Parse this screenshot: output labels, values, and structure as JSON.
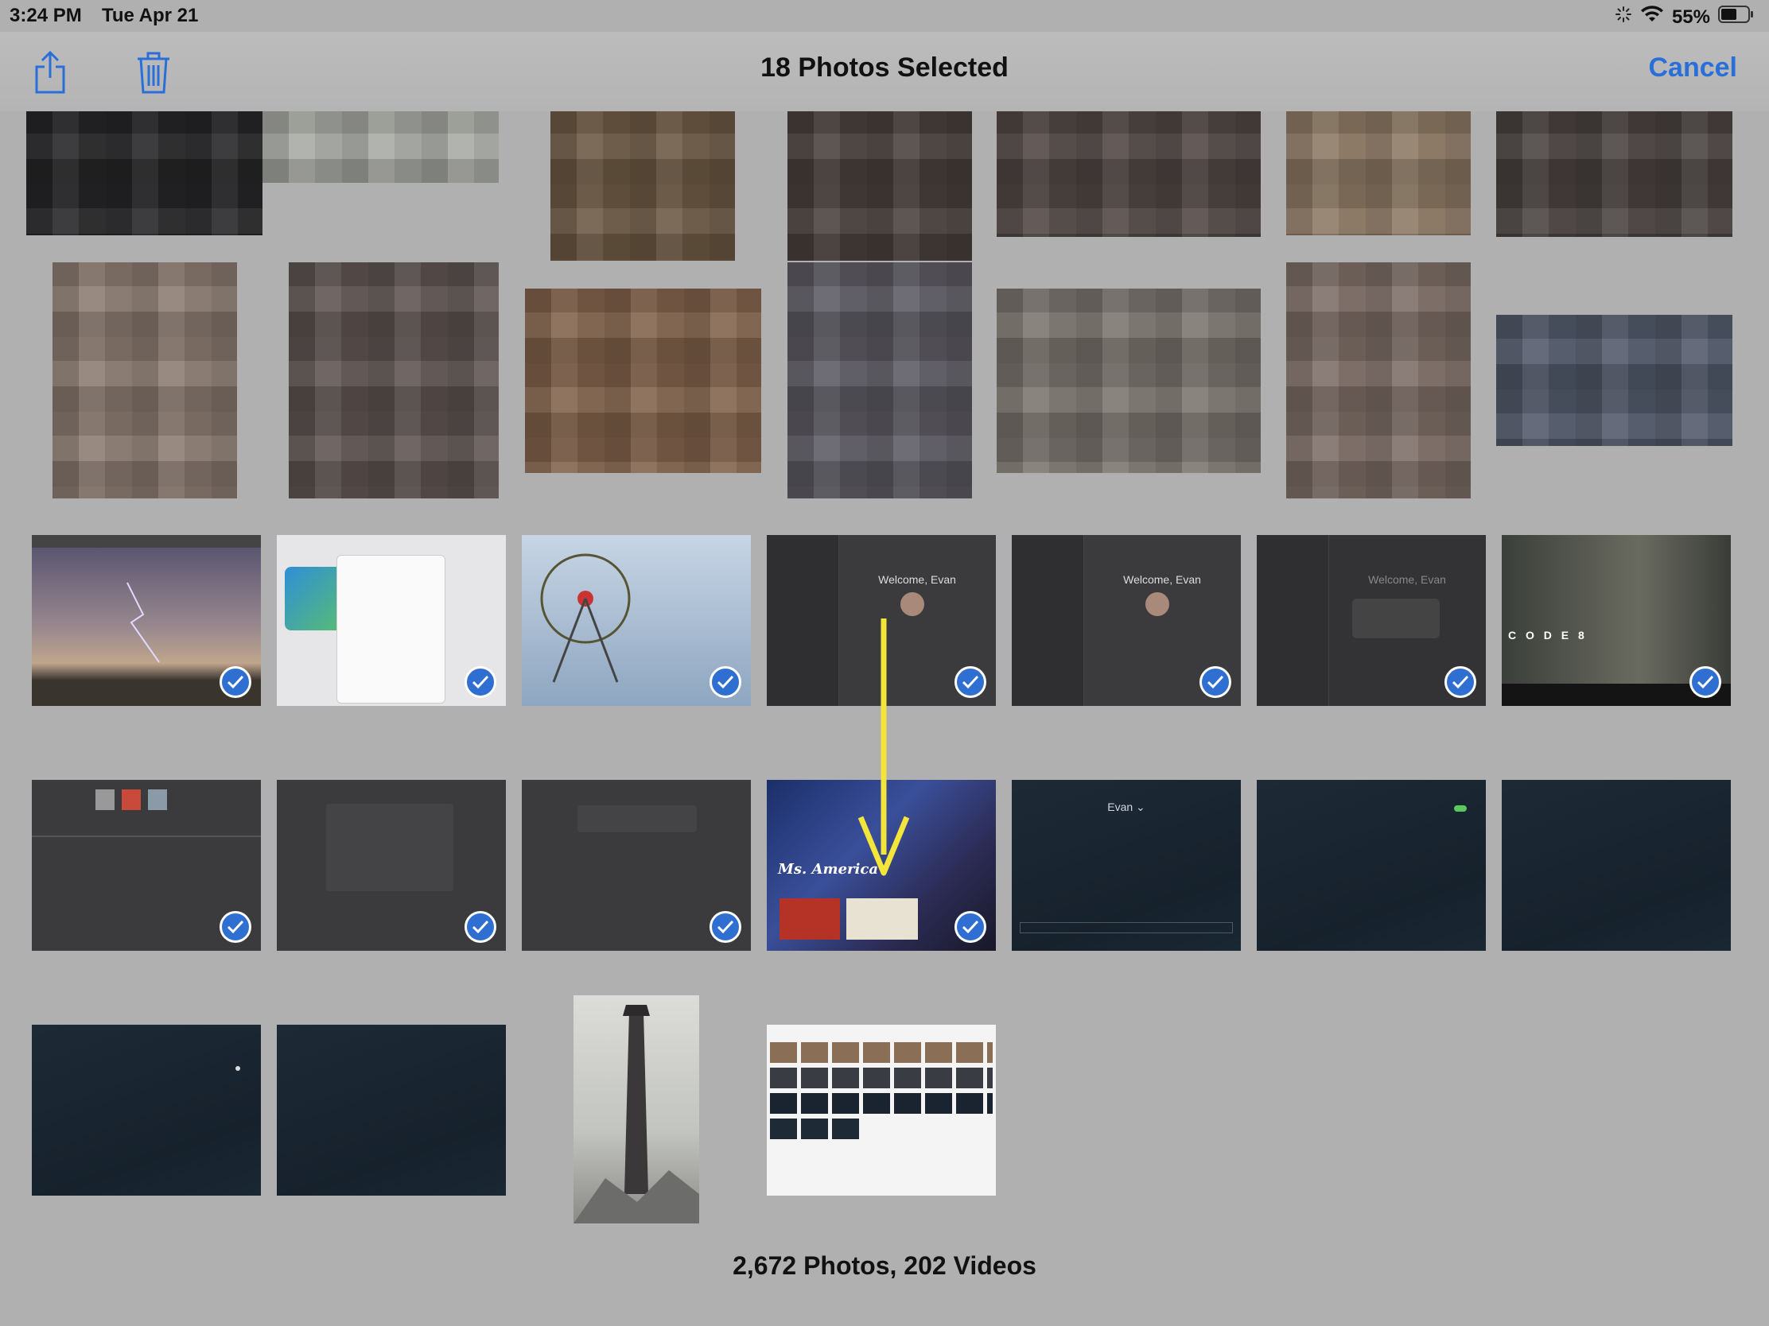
{
  "status_bar": {
    "time": "3:24 PM",
    "date": "Tue Apr 21",
    "battery": "55%"
  },
  "toolbar": {
    "title": "18 Photos Selected",
    "cancel_label": "Cancel",
    "share_icon": "share-icon",
    "trash_icon": "trash-icon"
  },
  "thumbs": {
    "welcome_1": "Welcome, Evan",
    "welcome_2": "Welcome, Evan",
    "welcome_3": "Welcome, Evan",
    "evan_menu": "Evan ⌄",
    "poster_title": "Ms. America",
    "code_title": "C O D E 8"
  },
  "footer": {
    "count": "2,672 Photos, 202 Videos"
  },
  "colors": {
    "accent": "#2a6fd9",
    "check": "#2f6fd1",
    "arrow": "#f3e53a"
  }
}
